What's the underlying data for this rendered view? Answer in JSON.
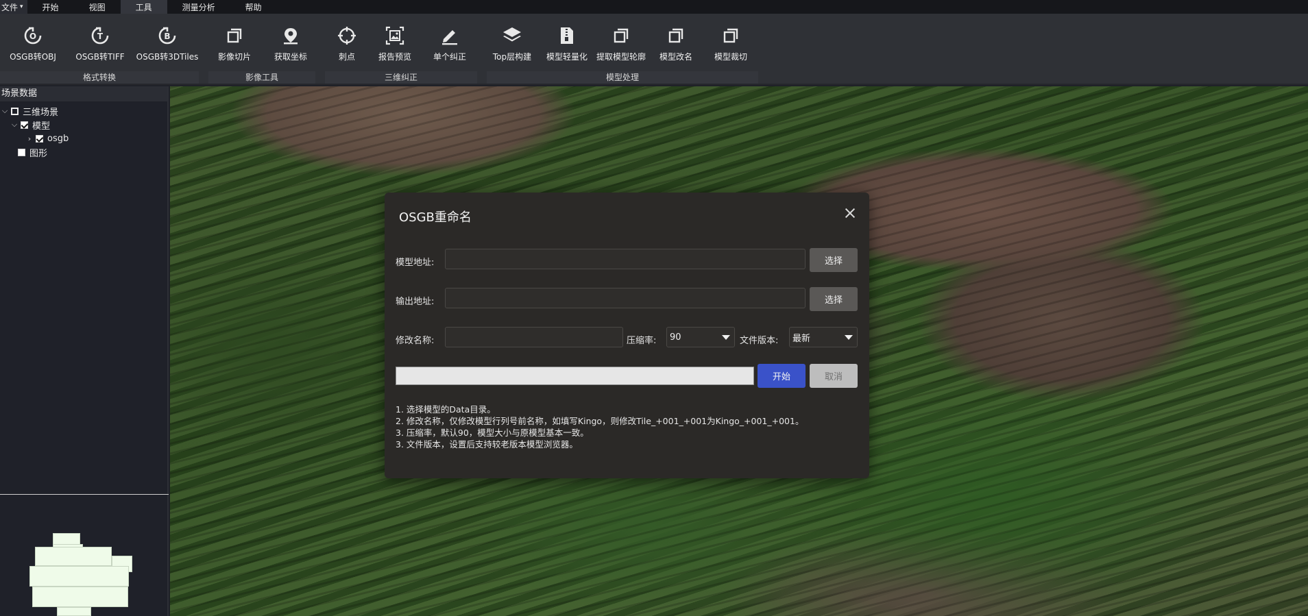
{
  "menubar": {
    "file": "文件",
    "items": [
      "开始",
      "视图",
      "工具",
      "测量分析",
      "帮助"
    ],
    "active": "工具"
  },
  "ribbon": {
    "tools": [
      {
        "label": "OSGB转OBJ",
        "icon": "obj-convert-icon"
      },
      {
        "label": "OSGB转TIFF",
        "icon": "tiff-convert-icon"
      },
      {
        "label": "OSGB转3DTiles",
        "icon": "3dtiles-convert-icon"
      },
      {
        "label": "影像切片",
        "icon": "image-slice-icon"
      },
      {
        "label": "获取坐标",
        "icon": "location-pin-icon"
      },
      {
        "label": "刺点",
        "icon": "crosshair-icon"
      },
      {
        "label": "报告预览",
        "icon": "report-preview-icon"
      },
      {
        "label": "单个纠正",
        "icon": "pencil-icon"
      },
      {
        "label": "Top层构建",
        "icon": "layers-icon"
      },
      {
        "label": "模型轻量化",
        "icon": "zip-file-icon"
      },
      {
        "label": "提取模型轮廓",
        "icon": "outline-icon"
      },
      {
        "label": "模型改名",
        "icon": "rename-icon"
      },
      {
        "label": "模型裁切",
        "icon": "clip-icon"
      }
    ],
    "groups": [
      "格式转换",
      "影像工具",
      "三维纠正",
      "模型处理"
    ]
  },
  "left_panel": {
    "title": "场景数据",
    "tree": {
      "root": "三维场景",
      "model": "模型",
      "osgb": "osgb",
      "shape": "图形"
    }
  },
  "dialog": {
    "title": "OSGB重命名",
    "model_path_label": "模型地址:",
    "model_path_value": "",
    "output_path_label": "输出地址:",
    "output_path_value": "",
    "select_label": "选择",
    "rename_label": "修改名称:",
    "rename_value": "",
    "compression_label": "压缩率:",
    "compression_value": "90",
    "version_label": "文件版本:",
    "version_value": "最新",
    "progress": 0,
    "start_label": "开始",
    "cancel_label": "取消",
    "notes": [
      "1. 选择模型的Data目录。",
      "2. 修改名称，仅修改模型行列号前名称，如填写Kingo，则修改Tile_+001_+001为Kingo_+001_+001。",
      "3. 压缩率，默认90，模型大小与原模型基本一致。",
      "3. 文件版本，设置后支持较老版本模型浏览器。"
    ]
  },
  "colors": {
    "accent": "#3a52c9",
    "ribbon_bg": "#2f3136",
    "panel_bg": "#1f2129",
    "dialog_bg": "#2b2927"
  }
}
